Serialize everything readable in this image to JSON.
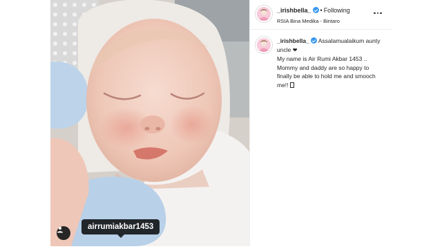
{
  "post": {
    "username": "_irishbella_",
    "follow_status": "Following",
    "location": "RSIA Bina Medika - Bintaro",
    "tagged_user": "airrumiakbar1453",
    "caption_lines": [
      "Assalamualaikum aunty uncle",
      "My name is Air Rumi Akbar 1453 .. Mommy and daddy are so happy to finally be able to hold me and smooch me!!"
    ]
  },
  "icons": {
    "verified": "verified-badge-icon",
    "more": "more-options-icon",
    "tag": "user-tag-icon",
    "heart": "heart-icon"
  },
  "colors": {
    "verified_blue": "#3897f0",
    "text": "#262626",
    "border": "#efefef"
  }
}
